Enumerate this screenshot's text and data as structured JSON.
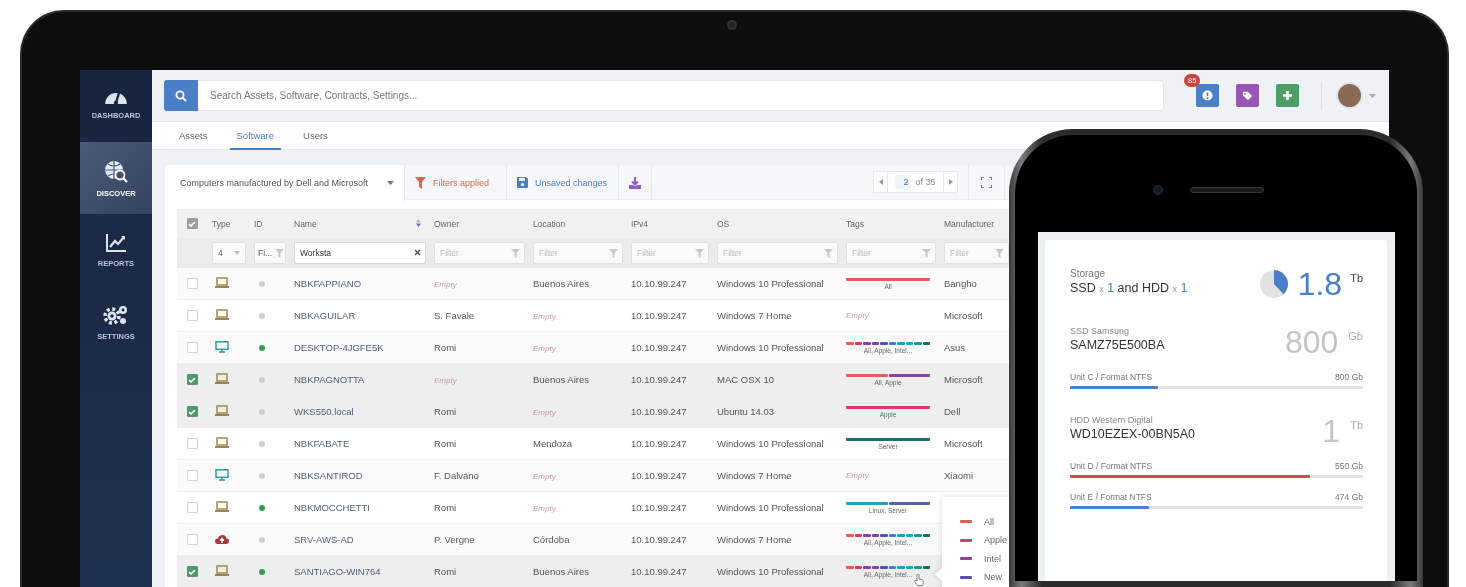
{
  "sidebar": {
    "items": [
      {
        "kind": "dashboard",
        "label": "DASHBOARD",
        "selected": false
      },
      {
        "kind": "discover",
        "label": "DISCOVER",
        "selected": true
      },
      {
        "kind": "reports",
        "label": "REPORTS",
        "selected": false
      },
      {
        "kind": "settings",
        "label": "SETTINGS",
        "selected": false
      }
    ]
  },
  "topbar": {
    "search": {
      "placeholder": "Search Assets, Software, Contracts, Settings..."
    },
    "actions": [
      {
        "kind": "alert",
        "badge": "85"
      },
      {
        "kind": "tag"
      },
      {
        "kind": "add"
      }
    ]
  },
  "tabs": [
    {
      "label": "Assets",
      "selected": false
    },
    {
      "label": "Software",
      "selected": true
    },
    {
      "label": "Users",
      "selected": false
    }
  ],
  "toolbar": {
    "view": "Computers manufactured by Dell and Microsoft",
    "filters": "Filters applied",
    "unsaved": "Unsaved changes",
    "pager": {
      "page": "2",
      "total": "of 35"
    }
  },
  "table": {
    "header_checked": true,
    "columns": [
      {
        "label": "Type",
        "sorted": false
      },
      {
        "label": "ID",
        "sorted": false
      },
      {
        "label": "Name",
        "sorted": true
      },
      {
        "label": "Owner",
        "sorted": false
      },
      {
        "label": "Location",
        "sorted": false
      },
      {
        "label": "IPv4",
        "sorted": false
      },
      {
        "label": "OS",
        "sorted": false
      },
      {
        "label": "Tags",
        "sorted": false
      },
      {
        "label": "Manufacturer",
        "sorted": false
      }
    ],
    "filters": [
      {
        "kind": "select",
        "value": "4"
      },
      {
        "kind": "filter",
        "value": "Fi..."
      },
      {
        "kind": "search",
        "value": "Worksta"
      },
      {
        "kind": "filter",
        "placeholder": "Filter"
      },
      {
        "kind": "filter",
        "placeholder": "Filter"
      },
      {
        "kind": "filter",
        "placeholder": "Filter"
      },
      {
        "kind": "filter",
        "placeholder": "Filter"
      },
      {
        "kind": "filter",
        "placeholder": "Filter"
      },
      {
        "kind": "filter",
        "placeholder": "Filter"
      }
    ],
    "rows": [
      {
        "checked": false,
        "kind": "laptop",
        "online": false,
        "name": "NBKFAPPIANO",
        "owner": {
          "text": "Empty",
          "empty": true
        },
        "location": {
          "text": "Buenos Aires",
          "empty": false
        },
        "ipv4": "10.10.99.247",
        "os": "Windows 10 Professional",
        "tags": {
          "text": "All",
          "empty": false,
          "segments": [
            {
              "color": "#dd5f55"
            }
          ]
        },
        "manufacturer": "Bangho"
      },
      {
        "checked": false,
        "kind": "laptop",
        "online": false,
        "name": "NBKAGUILAR",
        "owner": {
          "text": "S. Favale",
          "empty": false
        },
        "location": {
          "text": "Empty",
          "empty": true
        },
        "ipv4": "10.10.99.247",
        "os": "Windows 7 Home",
        "tags": {
          "text": "Empty",
          "empty": true
        },
        "manufacturer": "Microsoft"
      },
      {
        "checked": false,
        "kind": "desktop",
        "online": true,
        "name": "DESKTOP-4JGFE5K",
        "owner": {
          "text": "Romi",
          "empty": false
        },
        "location": {
          "text": "Empty",
          "empty": true
        },
        "ipv4": "10.10.99.247",
        "os": "Windows 10 Professional",
        "tags": {
          "text": "All, Apple, Intel...",
          "empty": false,
          "segments": [
            {
              "color": "#dd5f55"
            },
            {
              "color": "#cc3f6b"
            },
            {
              "color": "#8e3fa0"
            },
            {
              "color": "#7a44a8"
            },
            {
              "color": "#5b4ea8"
            },
            {
              "color": "#3d7fc9"
            },
            {
              "color": "#2f95d0"
            },
            {
              "color": "#22a5b5"
            },
            {
              "color": "#1a9a9a"
            },
            {
              "color": "#1b6f5a"
            }
          ]
        },
        "manufacturer": "Asus"
      },
      {
        "checked": true,
        "kind": "laptop",
        "online": false,
        "name": "NBKPAGNOTTA",
        "owner": {
          "text": "Empty",
          "empty": true
        },
        "location": {
          "text": "Buenos Aires",
          "empty": false
        },
        "ipv4": "10.10.99.247",
        "os": "MAC OSX 10",
        "tags": {
          "text": "All, Apple",
          "empty": false,
          "segments": [
            {
              "color": "#dd5f55"
            },
            {
              "color": "#8e3fa0"
            }
          ]
        },
        "manufacturer": "Microsoft"
      },
      {
        "checked": true,
        "kind": "laptop",
        "online": false,
        "name": "WKS550.local",
        "owner": {
          "text": "Romi",
          "empty": false
        },
        "location": {
          "text": "Empty",
          "empty": true
        },
        "ipv4": "10.10.99.247",
        "os": "Ubuntu 14.03",
        "tags": {
          "text": "Apple",
          "empty": false,
          "segments": [
            {
              "color": "#cc3f6b"
            }
          ]
        },
        "manufacturer": "Dell"
      },
      {
        "checked": false,
        "kind": "laptop",
        "online": false,
        "name": "NBKFABATE",
        "owner": {
          "text": "Romi",
          "empty": false
        },
        "location": {
          "text": "Mendoza",
          "empty": false
        },
        "ipv4": "10.10.99.247",
        "os": "Windows 10 Professional",
        "tags": {
          "text": "Server",
          "empty": false,
          "segments": [
            {
              "color": "#1b6f63"
            }
          ]
        },
        "manufacturer": "Microsoft"
      },
      {
        "checked": false,
        "kind": "desktop",
        "online": false,
        "name": "NBKSANTIROD",
        "owner": {
          "text": "F. Dalvano",
          "empty": false
        },
        "location": {
          "text": "Empty",
          "empty": true
        },
        "ipv4": "10.10.99.247",
        "os": "Windows 7 Home",
        "tags": {
          "text": "Empty",
          "empty": true
        },
        "manufacturer": "Xiaomi"
      },
      {
        "checked": false,
        "kind": "laptop",
        "online": true,
        "name": "NBKMOCCHETTI",
        "owner": {
          "text": "Romi",
          "empty": false
        },
        "location": {
          "text": "Empty",
          "empty": true
        },
        "ipv4": "10.10.99.247",
        "os": "Windows 10 Professional",
        "tags": {
          "text": "Linux, Server",
          "empty": false,
          "segments": [
            {
              "color": "#2a9dbf"
            },
            {
              "color": "#5b5ea8"
            }
          ]
        }
      },
      {
        "checked": false,
        "kind": "cloud",
        "online": false,
        "name": "SRV-AWS-AD",
        "owner": {
          "text": "P. Vergne",
          "empty": false
        },
        "location": {
          "text": "Córdoba",
          "empty": false
        },
        "ipv4": "10.10.99.247",
        "os": "Windows 7 Home",
        "tags": {
          "text": "All, Apple, Intel...",
          "empty": false,
          "segments": [
            {
              "color": "#dd5f55"
            },
            {
              "color": "#cc3f6b"
            },
            {
              "color": "#8e3fa0"
            },
            {
              "color": "#7a44a8"
            },
            {
              "color": "#5b4ea8"
            },
            {
              "color": "#3d7fc9"
            },
            {
              "color": "#2f95d0"
            },
            {
              "color": "#22a5b5"
            },
            {
              "color": "#1a9a9a"
            },
            {
              "color": "#1b6f5a"
            }
          ]
        }
      },
      {
        "checked": true,
        "kind": "laptop",
        "online": true,
        "name": "SANTIAGO-WIN764",
        "owner": {
          "text": "Romi",
          "empty": false
        },
        "location": {
          "text": "Buenos Aires",
          "empty": false
        },
        "ipv4": "10.10.99.247",
        "os": "Windows 10 Professional",
        "tags": {
          "text": "All, Apple, Intel...",
          "empty": false,
          "segments": [
            {
              "color": "#dd5f55"
            },
            {
              "color": "#cc3f6b"
            },
            {
              "color": "#8e3fa0"
            },
            {
              "color": "#7a44a8"
            },
            {
              "color": "#5b4ea8"
            },
            {
              "color": "#3d7fc9"
            },
            {
              "color": "#2f95d0"
            },
            {
              "color": "#22a5b5"
            },
            {
              "color": "#1a9a9a"
            },
            {
              "color": "#1b6f5a"
            }
          ]
        }
      }
    ]
  },
  "tag_popover": {
    "items": [
      {
        "label": "All",
        "color": "#dd5f55"
      },
      {
        "label": "Apple",
        "color": "#cc3f6b"
      },
      {
        "label": "Intel",
        "color": "#8e3fa0"
      },
      {
        "label": "New",
        "color": "#5b4ea8"
      }
    ]
  },
  "phone": {
    "storage": {
      "label": "Storage",
      "summary": [
        {
          "kind": "name",
          "text": "SSD"
        },
        {
          "kind": "times",
          "text": "x"
        },
        {
          "kind": "count",
          "text": "1"
        },
        {
          "kind": "name",
          "text": "and HDD"
        },
        {
          "kind": "times",
          "text": "x"
        },
        {
          "kind": "count",
          "text": "1"
        }
      ],
      "total": "1.8",
      "unit": "Tb"
    },
    "drives": [
      {
        "label": "SSD Samsung",
        "model": "SAMZ75E500BA",
        "size": "800",
        "unit": "Gb",
        "partitions": [
          {
            "name": "Unit C / Format NTFS",
            "size": "800 Gb",
            "level": 0.3,
            "color": "#4a7fc8"
          }
        ]
      },
      {
        "label": "HDD Western Digital",
        "model": "WD10EZEX-00BN5A0",
        "size": "1",
        "unit": "Tb",
        "partitions": [
          {
            "name": "Unit D / Format NTFS",
            "size": "550 Gb",
            "level": 0.82,
            "color": "#d04a4a"
          },
          {
            "name": "Unit E / Format NTFS",
            "size": "474 Gb",
            "level": 0.27,
            "color": "#4a7fc8"
          }
        ]
      }
    ]
  }
}
